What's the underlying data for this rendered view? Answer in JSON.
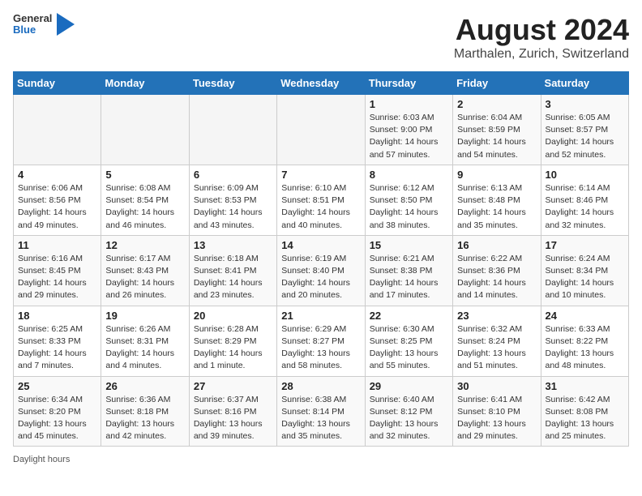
{
  "header": {
    "logo_general": "General",
    "logo_blue": "Blue",
    "main_title": "August 2024",
    "subtitle": "Marthalen, Zurich, Switzerland"
  },
  "weekdays": [
    "Sunday",
    "Monday",
    "Tuesday",
    "Wednesday",
    "Thursday",
    "Friday",
    "Saturday"
  ],
  "weeks": [
    [
      {
        "day": "",
        "sunrise": "",
        "sunset": "",
        "daylight": ""
      },
      {
        "day": "",
        "sunrise": "",
        "sunset": "",
        "daylight": ""
      },
      {
        "day": "",
        "sunrise": "",
        "sunset": "",
        "daylight": ""
      },
      {
        "day": "",
        "sunrise": "",
        "sunset": "",
        "daylight": ""
      },
      {
        "day": "1",
        "sunrise": "Sunrise: 6:03 AM",
        "sunset": "Sunset: 9:00 PM",
        "daylight": "Daylight: 14 hours and 57 minutes."
      },
      {
        "day": "2",
        "sunrise": "Sunrise: 6:04 AM",
        "sunset": "Sunset: 8:59 PM",
        "daylight": "Daylight: 14 hours and 54 minutes."
      },
      {
        "day": "3",
        "sunrise": "Sunrise: 6:05 AM",
        "sunset": "Sunset: 8:57 PM",
        "daylight": "Daylight: 14 hours and 52 minutes."
      }
    ],
    [
      {
        "day": "4",
        "sunrise": "Sunrise: 6:06 AM",
        "sunset": "Sunset: 8:56 PM",
        "daylight": "Daylight: 14 hours and 49 minutes."
      },
      {
        "day": "5",
        "sunrise": "Sunrise: 6:08 AM",
        "sunset": "Sunset: 8:54 PM",
        "daylight": "Daylight: 14 hours and 46 minutes."
      },
      {
        "day": "6",
        "sunrise": "Sunrise: 6:09 AM",
        "sunset": "Sunset: 8:53 PM",
        "daylight": "Daylight: 14 hours and 43 minutes."
      },
      {
        "day": "7",
        "sunrise": "Sunrise: 6:10 AM",
        "sunset": "Sunset: 8:51 PM",
        "daylight": "Daylight: 14 hours and 40 minutes."
      },
      {
        "day": "8",
        "sunrise": "Sunrise: 6:12 AM",
        "sunset": "Sunset: 8:50 PM",
        "daylight": "Daylight: 14 hours and 38 minutes."
      },
      {
        "day": "9",
        "sunrise": "Sunrise: 6:13 AM",
        "sunset": "Sunset: 8:48 PM",
        "daylight": "Daylight: 14 hours and 35 minutes."
      },
      {
        "day": "10",
        "sunrise": "Sunrise: 6:14 AM",
        "sunset": "Sunset: 8:46 PM",
        "daylight": "Daylight: 14 hours and 32 minutes."
      }
    ],
    [
      {
        "day": "11",
        "sunrise": "Sunrise: 6:16 AM",
        "sunset": "Sunset: 8:45 PM",
        "daylight": "Daylight: 14 hours and 29 minutes."
      },
      {
        "day": "12",
        "sunrise": "Sunrise: 6:17 AM",
        "sunset": "Sunset: 8:43 PM",
        "daylight": "Daylight: 14 hours and 26 minutes."
      },
      {
        "day": "13",
        "sunrise": "Sunrise: 6:18 AM",
        "sunset": "Sunset: 8:41 PM",
        "daylight": "Daylight: 14 hours and 23 minutes."
      },
      {
        "day": "14",
        "sunrise": "Sunrise: 6:19 AM",
        "sunset": "Sunset: 8:40 PM",
        "daylight": "Daylight: 14 hours and 20 minutes."
      },
      {
        "day": "15",
        "sunrise": "Sunrise: 6:21 AM",
        "sunset": "Sunset: 8:38 PM",
        "daylight": "Daylight: 14 hours and 17 minutes."
      },
      {
        "day": "16",
        "sunrise": "Sunrise: 6:22 AM",
        "sunset": "Sunset: 8:36 PM",
        "daylight": "Daylight: 14 hours and 14 minutes."
      },
      {
        "day": "17",
        "sunrise": "Sunrise: 6:24 AM",
        "sunset": "Sunset: 8:34 PM",
        "daylight": "Daylight: 14 hours and 10 minutes."
      }
    ],
    [
      {
        "day": "18",
        "sunrise": "Sunrise: 6:25 AM",
        "sunset": "Sunset: 8:33 PM",
        "daylight": "Daylight: 14 hours and 7 minutes."
      },
      {
        "day": "19",
        "sunrise": "Sunrise: 6:26 AM",
        "sunset": "Sunset: 8:31 PM",
        "daylight": "Daylight: 14 hours and 4 minutes."
      },
      {
        "day": "20",
        "sunrise": "Sunrise: 6:28 AM",
        "sunset": "Sunset: 8:29 PM",
        "daylight": "Daylight: 14 hours and 1 minute."
      },
      {
        "day": "21",
        "sunrise": "Sunrise: 6:29 AM",
        "sunset": "Sunset: 8:27 PM",
        "daylight": "Daylight: 13 hours and 58 minutes."
      },
      {
        "day": "22",
        "sunrise": "Sunrise: 6:30 AM",
        "sunset": "Sunset: 8:25 PM",
        "daylight": "Daylight: 13 hours and 55 minutes."
      },
      {
        "day": "23",
        "sunrise": "Sunrise: 6:32 AM",
        "sunset": "Sunset: 8:24 PM",
        "daylight": "Daylight: 13 hours and 51 minutes."
      },
      {
        "day": "24",
        "sunrise": "Sunrise: 6:33 AM",
        "sunset": "Sunset: 8:22 PM",
        "daylight": "Daylight: 13 hours and 48 minutes."
      }
    ],
    [
      {
        "day": "25",
        "sunrise": "Sunrise: 6:34 AM",
        "sunset": "Sunset: 8:20 PM",
        "daylight": "Daylight: 13 hours and 45 minutes."
      },
      {
        "day": "26",
        "sunrise": "Sunrise: 6:36 AM",
        "sunset": "Sunset: 8:18 PM",
        "daylight": "Daylight: 13 hours and 42 minutes."
      },
      {
        "day": "27",
        "sunrise": "Sunrise: 6:37 AM",
        "sunset": "Sunset: 8:16 PM",
        "daylight": "Daylight: 13 hours and 39 minutes."
      },
      {
        "day": "28",
        "sunrise": "Sunrise: 6:38 AM",
        "sunset": "Sunset: 8:14 PM",
        "daylight": "Daylight: 13 hours and 35 minutes."
      },
      {
        "day": "29",
        "sunrise": "Sunrise: 6:40 AM",
        "sunset": "Sunset: 8:12 PM",
        "daylight": "Daylight: 13 hours and 32 minutes."
      },
      {
        "day": "30",
        "sunrise": "Sunrise: 6:41 AM",
        "sunset": "Sunset: 8:10 PM",
        "daylight": "Daylight: 13 hours and 29 minutes."
      },
      {
        "day": "31",
        "sunrise": "Sunrise: 6:42 AM",
        "sunset": "Sunset: 8:08 PM",
        "daylight": "Daylight: 13 hours and 25 minutes."
      }
    ]
  ],
  "footer": {
    "daylight_label": "Daylight hours"
  }
}
